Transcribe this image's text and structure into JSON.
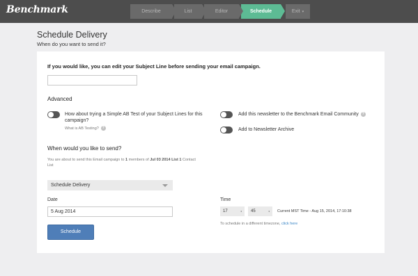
{
  "app": {
    "logo": "Benchmark"
  },
  "steps": [
    {
      "label": "Describe"
    },
    {
      "label": "List"
    },
    {
      "label": "Editor"
    },
    {
      "label": "Schedule"
    }
  ],
  "exit_label": "Exit",
  "exit_caret": "▾",
  "header": {
    "title": "Schedule Delivery",
    "subtitle": "When do you want to send it?"
  },
  "subject": {
    "prompt": "If you would like, you can edit your Subject Line before sending your email campaign.",
    "value": ""
  },
  "advanced": {
    "heading": "Advanced",
    "ab_test": "How about trying a Simple AB Test of your Subject Lines for this campaign?",
    "ab_link": "What is AB Testing?",
    "community": "Add this newsletter to the Benchmark Email Community",
    "archive": "Add to Newsletter Archive",
    "help_glyph": "?"
  },
  "when": {
    "heading": "When would you like to send?",
    "info_prefix": "You are about to send this Email campaign to",
    "info_count": "1",
    "info_middle": "members of",
    "info_list": "Jul 03 2014 List 1",
    "info_suffix": "Contact List"
  },
  "delivery_select": {
    "value": "Schedule Delivery"
  },
  "date": {
    "label": "Date",
    "value": "5 Aug 2014"
  },
  "time": {
    "label": "Time",
    "hour": "17",
    "minute": "45",
    "caret": "◂",
    "current": "Current MST Time -  Aug 15, 2014, 17:10:38",
    "tz_note": "To schedule in a different timezone,",
    "tz_link": "click here"
  },
  "button": {
    "label": "Schedule"
  }
}
